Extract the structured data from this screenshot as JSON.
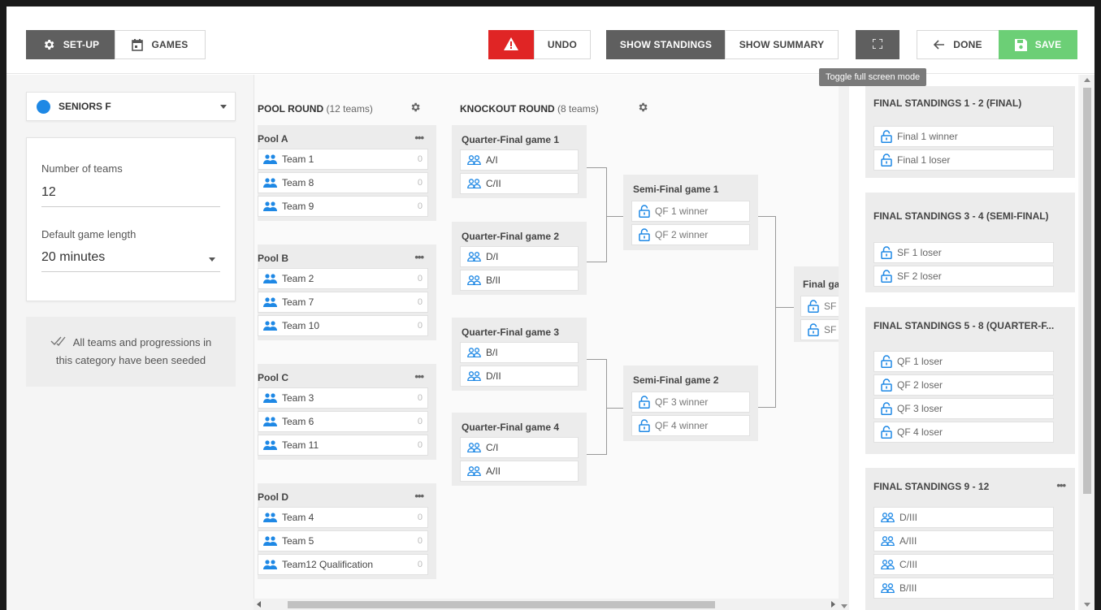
{
  "toolbar": {
    "setup_label": "SET-UP",
    "games_label": "GAMES",
    "undo_label": "UNDO",
    "show_standings_label": "SHOW STANDINGS",
    "show_summary_label": "SHOW SUMMARY",
    "done_label": "DONE",
    "save_label": "SAVE",
    "fullscreen_tooltip": "Toggle full screen mode"
  },
  "sidebar": {
    "category": "SENIORS F",
    "category_color": "#1e88e5",
    "num_teams_label": "Number of teams",
    "num_teams_value": "12",
    "game_length_label": "Default game length",
    "game_length_value": "20 minutes",
    "seeded_line1": "All teams and progressions in",
    "seeded_line2": "this category have been seeded"
  },
  "pool_round": {
    "title": "POOL ROUND",
    "sub": "(12 teams)",
    "pools": [
      {
        "name": "Pool A",
        "teams": [
          {
            "name": "Team 1",
            "score": "0"
          },
          {
            "name": "Team 8",
            "score": "0"
          },
          {
            "name": "Team 9",
            "score": "0"
          }
        ]
      },
      {
        "name": "Pool B",
        "teams": [
          {
            "name": "Team 2",
            "score": "0"
          },
          {
            "name": "Team 7",
            "score": "0"
          },
          {
            "name": "Team 10",
            "score": "0"
          }
        ]
      },
      {
        "name": "Pool C",
        "teams": [
          {
            "name": "Team 3",
            "score": "0"
          },
          {
            "name": "Team 6",
            "score": "0"
          },
          {
            "name": "Team 11",
            "score": "0"
          }
        ]
      },
      {
        "name": "Pool D",
        "teams": [
          {
            "name": "Team 4",
            "score": "0"
          },
          {
            "name": "Team 5",
            "score": "0"
          },
          {
            "name": "Team12 Qualification",
            "score": "0"
          }
        ]
      }
    ],
    "more": "•••"
  },
  "knockout": {
    "title": "KNOCKOUT ROUND",
    "sub": "(8 teams)",
    "qf": [
      {
        "name": "Quarter-Final game 1",
        "slots": [
          "A/I",
          "C/II"
        ]
      },
      {
        "name": "Quarter-Final game 2",
        "slots": [
          "D/I",
          "B/II"
        ]
      },
      {
        "name": "Quarter-Final game 3",
        "slots": [
          "B/I",
          "D/II"
        ]
      },
      {
        "name": "Quarter-Final game 4",
        "slots": [
          "C/I",
          "A/II"
        ]
      }
    ],
    "sf": [
      {
        "name": "Semi-Final game 1",
        "slots": [
          "QF 1 winner",
          "QF 2 winner"
        ]
      },
      {
        "name": "Semi-Final game 2",
        "slots": [
          "QF 3 winner",
          "QF 4 winner"
        ]
      }
    ],
    "final": {
      "name": "Final ga",
      "slots": [
        "SF",
        "SF"
      ]
    }
  },
  "standings": [
    {
      "title": "FINAL STANDINGS 1 - 2 (FINAL)",
      "slots": [
        "Final 1 winner",
        "Final 1 loser"
      ],
      "locked": true
    },
    {
      "title": "FINAL STANDINGS 3 - 4 (SEMI-FINAL)",
      "slots": [
        "SF 1 loser",
        "SF 2 loser"
      ],
      "locked": true
    },
    {
      "title": "FINAL STANDINGS 5 - 8 (QUARTER-F...",
      "slots": [
        "QF 1 loser",
        "QF 2 loser",
        "QF 3 loser",
        "QF 4 loser"
      ],
      "locked": true
    },
    {
      "title": "FINAL STANDINGS 9 - 12",
      "slots": [
        "D/III",
        "A/III",
        "C/III",
        "B/III"
      ],
      "locked": false,
      "more": "•••"
    }
  ],
  "colors": {
    "accent": "#1e88e5",
    "danger": "#e02525",
    "success": "#6ccf76",
    "dark": "#5f5f5f"
  }
}
